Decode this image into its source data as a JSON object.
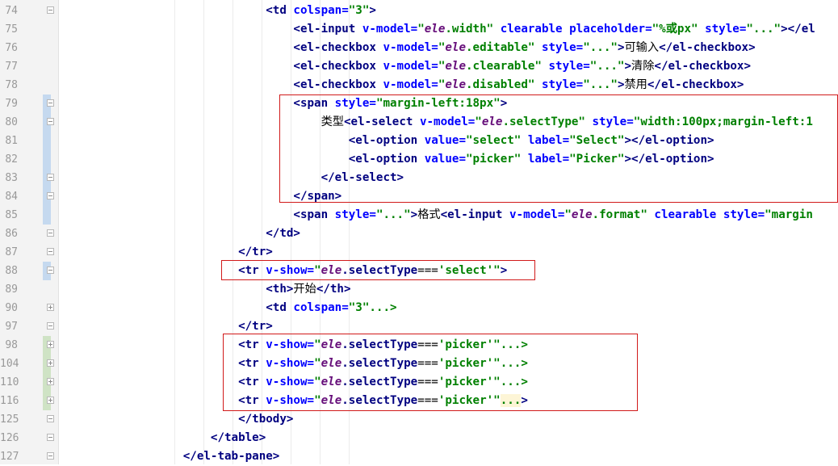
{
  "lines": [
    {
      "num": "74",
      "fold": "minus",
      "vcs": "none",
      "code": [
        {
          "t": "                              "
        },
        {
          "t": "<td ",
          "c": "tag"
        },
        {
          "t": "colspan",
          "c": "attr"
        },
        {
          "t": "=",
          "c": "attr"
        },
        {
          "t": "\"3\"",
          "c": "str"
        },
        {
          "t": ">",
          "c": "tag"
        }
      ]
    },
    {
      "num": "75",
      "fold": "",
      "vcs": "none",
      "code": [
        {
          "t": "                                  "
        },
        {
          "t": "<el-input ",
          "c": "tag"
        },
        {
          "t": "v-model",
          "c": "attr"
        },
        {
          "t": "=",
          "c": "attr"
        },
        {
          "t": "\"",
          "c": "str"
        },
        {
          "t": "ele",
          "c": "vvar"
        },
        {
          "t": ".width\"",
          "c": "str"
        },
        {
          "t": " "
        },
        {
          "t": "clearable",
          "c": "attr"
        },
        {
          "t": " "
        },
        {
          "t": "placeholder",
          "c": "attr"
        },
        {
          "t": "=",
          "c": "attr"
        },
        {
          "t": "\"%或px\"",
          "c": "str"
        },
        {
          "t": " "
        },
        {
          "t": "style",
          "c": "attr"
        },
        {
          "t": "=",
          "c": "attr"
        },
        {
          "t": "\"...\"",
          "c": "str"
        },
        {
          "t": "></el",
          "c": "tag"
        }
      ]
    },
    {
      "num": "76",
      "fold": "",
      "vcs": "none",
      "code": [
        {
          "t": "                                  "
        },
        {
          "t": "<el-checkbox ",
          "c": "tag"
        },
        {
          "t": "v-model",
          "c": "attr"
        },
        {
          "t": "=",
          "c": "attr"
        },
        {
          "t": "\"",
          "c": "str"
        },
        {
          "t": "ele",
          "c": "vvar"
        },
        {
          "t": ".editable\"",
          "c": "str"
        },
        {
          "t": " "
        },
        {
          "t": "style",
          "c": "attr"
        },
        {
          "t": "=",
          "c": "attr"
        },
        {
          "t": "\"...\"",
          "c": "str"
        },
        {
          "t": ">",
          "c": "tag"
        },
        {
          "t": "可输入",
          "c": "txt"
        },
        {
          "t": "</el-checkbox>",
          "c": "tag"
        }
      ]
    },
    {
      "num": "77",
      "fold": "",
      "vcs": "none",
      "code": [
        {
          "t": "                                  "
        },
        {
          "t": "<el-checkbox ",
          "c": "tag"
        },
        {
          "t": "v-model",
          "c": "attr"
        },
        {
          "t": "=",
          "c": "attr"
        },
        {
          "t": "\"",
          "c": "str"
        },
        {
          "t": "ele",
          "c": "vvar"
        },
        {
          "t": ".clearable\"",
          "c": "str"
        },
        {
          "t": " "
        },
        {
          "t": "style",
          "c": "attr"
        },
        {
          "t": "=",
          "c": "attr"
        },
        {
          "t": "\"...\"",
          "c": "str"
        },
        {
          "t": ">",
          "c": "tag"
        },
        {
          "t": "清除",
          "c": "txt"
        },
        {
          "t": "</el-checkbox>",
          "c": "tag"
        }
      ]
    },
    {
      "num": "78",
      "fold": "",
      "vcs": "none",
      "code": [
        {
          "t": "                                  "
        },
        {
          "t": "<el-checkbox ",
          "c": "tag"
        },
        {
          "t": "v-model",
          "c": "attr"
        },
        {
          "t": "=",
          "c": "attr"
        },
        {
          "t": "\"",
          "c": "str"
        },
        {
          "t": "ele",
          "c": "vvar"
        },
        {
          "t": ".disabled\"",
          "c": "str"
        },
        {
          "t": " "
        },
        {
          "t": "style",
          "c": "attr"
        },
        {
          "t": "=",
          "c": "attr"
        },
        {
          "t": "\"...\"",
          "c": "str"
        },
        {
          "t": ">",
          "c": "tag"
        },
        {
          "t": "禁用",
          "c": "txt"
        },
        {
          "t": "</el-checkbox>",
          "c": "tag"
        }
      ]
    },
    {
      "num": "79",
      "fold": "minus",
      "vcs": "mod",
      "code": [
        {
          "t": "                                  "
        },
        {
          "t": "<span ",
          "c": "tag"
        },
        {
          "t": "style",
          "c": "attr"
        },
        {
          "t": "=",
          "c": "attr"
        },
        {
          "t": "\"margin-left:18px\"",
          "c": "str"
        },
        {
          "t": ">",
          "c": "tag"
        }
      ]
    },
    {
      "num": "80",
      "fold": "minus",
      "vcs": "mod",
      "code": [
        {
          "t": "                                      "
        },
        {
          "t": "类型",
          "c": "txt"
        },
        {
          "t": "<el-select ",
          "c": "tag"
        },
        {
          "t": "v-model",
          "c": "attr"
        },
        {
          "t": "=",
          "c": "attr"
        },
        {
          "t": "\"",
          "c": "str"
        },
        {
          "t": "ele",
          "c": "vvar"
        },
        {
          "t": ".selectType\"",
          "c": "str"
        },
        {
          "t": " "
        },
        {
          "t": "style",
          "c": "attr"
        },
        {
          "t": "=",
          "c": "attr"
        },
        {
          "t": "\"width:100px;margin-left:1",
          "c": "str"
        }
      ]
    },
    {
      "num": "81",
      "fold": "",
      "vcs": "mod",
      "code": [
        {
          "t": "                                          "
        },
        {
          "t": "<el-option ",
          "c": "tag"
        },
        {
          "t": "value",
          "c": "attr"
        },
        {
          "t": "=",
          "c": "attr"
        },
        {
          "t": "\"select\"",
          "c": "str"
        },
        {
          "t": " "
        },
        {
          "t": "label",
          "c": "attr"
        },
        {
          "t": "=",
          "c": "attr"
        },
        {
          "t": "\"Select\"",
          "c": "str"
        },
        {
          "t": "></el-option>",
          "c": "tag"
        }
      ]
    },
    {
      "num": "82",
      "fold": "",
      "vcs": "mod",
      "code": [
        {
          "t": "                                          "
        },
        {
          "t": "<el-option ",
          "c": "tag"
        },
        {
          "t": "value",
          "c": "attr"
        },
        {
          "t": "=",
          "c": "attr"
        },
        {
          "t": "\"picker\"",
          "c": "str"
        },
        {
          "t": " "
        },
        {
          "t": "label",
          "c": "attr"
        },
        {
          "t": "=",
          "c": "attr"
        },
        {
          "t": "\"Picker\"",
          "c": "str"
        },
        {
          "t": "></el-option>",
          "c": "tag"
        }
      ]
    },
    {
      "num": "83",
      "fold": "minus",
      "vcs": "mod",
      "code": [
        {
          "t": "                                      "
        },
        {
          "t": "</el-select>",
          "c": "tag"
        }
      ]
    },
    {
      "num": "84",
      "fold": "minus",
      "vcs": "mod",
      "code": [
        {
          "t": "                                  "
        },
        {
          "t": "</span>",
          "c": "tag"
        }
      ]
    },
    {
      "num": "85",
      "fold": "",
      "vcs": "mod",
      "code": [
        {
          "t": "                                  "
        },
        {
          "t": "<span ",
          "c": "tag"
        },
        {
          "t": "style",
          "c": "attr"
        },
        {
          "t": "=",
          "c": "attr"
        },
        {
          "t": "\"...\"",
          "c": "str"
        },
        {
          "t": ">",
          "c": "tag"
        },
        {
          "t": "格式",
          "c": "txt"
        },
        {
          "t": "<el-input ",
          "c": "tag"
        },
        {
          "t": "v-model",
          "c": "attr"
        },
        {
          "t": "=",
          "c": "attr"
        },
        {
          "t": "\"",
          "c": "str"
        },
        {
          "t": "ele",
          "c": "vvar"
        },
        {
          "t": ".format\"",
          "c": "str"
        },
        {
          "t": " "
        },
        {
          "t": "clearable",
          "c": "attr"
        },
        {
          "t": " "
        },
        {
          "t": "style",
          "c": "attr"
        },
        {
          "t": "=",
          "c": "attr"
        },
        {
          "t": "\"margin",
          "c": "str"
        }
      ]
    },
    {
      "num": "86",
      "fold": "minus",
      "vcs": "none",
      "code": [
        {
          "t": "                              "
        },
        {
          "t": "</td>",
          "c": "tag"
        }
      ]
    },
    {
      "num": "87",
      "fold": "minus",
      "vcs": "none",
      "code": [
        {
          "t": "                          "
        },
        {
          "t": "</tr>",
          "c": "tag"
        }
      ]
    },
    {
      "num": "88",
      "fold": "minus",
      "vcs": "mod",
      "code": [
        {
          "t": "                          "
        },
        {
          "t": "<tr ",
          "c": "tag"
        },
        {
          "t": "v-show",
          "c": "attr"
        },
        {
          "t": "=",
          "c": "attr"
        },
        {
          "t": "\"",
          "c": "str"
        },
        {
          "t": "ele",
          "c": "vvar"
        },
        {
          "t": ".selectType",
          "c": "tag"
        },
        {
          "t": "===",
          "c": "txt"
        },
        {
          "t": "'select'",
          "c": "str"
        },
        {
          "t": "\"",
          "c": "str"
        },
        {
          "t": ">",
          "c": "tag"
        }
      ]
    },
    {
      "num": "89",
      "fold": "",
      "vcs": "none",
      "code": [
        {
          "t": "                              "
        },
        {
          "t": "<th>",
          "c": "tag"
        },
        {
          "t": "开始",
          "c": "txt"
        },
        {
          "t": "</th>",
          "c": "tag"
        }
      ]
    },
    {
      "num": "90",
      "fold": "plus",
      "vcs": "none",
      "code": [
        {
          "t": "                              "
        },
        {
          "t": "<td ",
          "c": "tag"
        },
        {
          "t": "colspan",
          "c": "attr"
        },
        {
          "t": "=",
          "c": "attr"
        },
        {
          "t": "\"3\"",
          "c": "str"
        },
        {
          "t": "...>",
          "c": "str"
        }
      ]
    },
    {
      "num": "97",
      "fold": "minus",
      "vcs": "none",
      "code": [
        {
          "t": "                          "
        },
        {
          "t": "</tr>",
          "c": "tag"
        }
      ]
    },
    {
      "num": "98",
      "fold": "plus",
      "vcs": "add",
      "code": [
        {
          "t": "                          "
        },
        {
          "t": "<tr ",
          "c": "tag"
        },
        {
          "t": "v-show",
          "c": "attr"
        },
        {
          "t": "=",
          "c": "attr"
        },
        {
          "t": "\"",
          "c": "str"
        },
        {
          "t": "ele",
          "c": "vvar"
        },
        {
          "t": ".selectType",
          "c": "tag"
        },
        {
          "t": "===",
          "c": "txt"
        },
        {
          "t": "'picker'",
          "c": "str"
        },
        {
          "t": "\"...>",
          "c": "str"
        }
      ]
    },
    {
      "num": "104",
      "fold": "plus",
      "vcs": "add",
      "code": [
        {
          "t": "                          "
        },
        {
          "t": "<tr ",
          "c": "tag"
        },
        {
          "t": "v-show",
          "c": "attr"
        },
        {
          "t": "=",
          "c": "attr"
        },
        {
          "t": "\"",
          "c": "str"
        },
        {
          "t": "ele",
          "c": "vvar"
        },
        {
          "t": ".selectType",
          "c": "tag"
        },
        {
          "t": "===",
          "c": "txt"
        },
        {
          "t": "'picker'",
          "c": "str"
        },
        {
          "t": "\"...>",
          "c": "str"
        }
      ]
    },
    {
      "num": "110",
      "fold": "plus",
      "vcs": "add",
      "code": [
        {
          "t": "                          "
        },
        {
          "t": "<tr ",
          "c": "tag"
        },
        {
          "t": "v-show",
          "c": "attr"
        },
        {
          "t": "=",
          "c": "attr"
        },
        {
          "t": "\"",
          "c": "str"
        },
        {
          "t": "ele",
          "c": "vvar"
        },
        {
          "t": ".selectType",
          "c": "tag"
        },
        {
          "t": "===",
          "c": "txt"
        },
        {
          "t": "'picker'",
          "c": "str"
        },
        {
          "t": "\"...>",
          "c": "str"
        }
      ]
    },
    {
      "num": "116",
      "fold": "plus",
      "vcs": "add",
      "code": [
        {
          "t": "                          "
        },
        {
          "t": "<tr ",
          "c": "tag"
        },
        {
          "t": "v-show",
          "c": "attr"
        },
        {
          "t": "=",
          "c": "attr"
        },
        {
          "t": "\"",
          "c": "str"
        },
        {
          "t": "ele",
          "c": "vvar"
        },
        {
          "t": ".selectType",
          "c": "tag"
        },
        {
          "t": "===",
          "c": "txt"
        },
        {
          "t": "'picker'",
          "c": "str"
        },
        {
          "t": "\"",
          "c": "str"
        },
        {
          "t": "...",
          "c": "str hl"
        },
        {
          "t": ">",
          "c": "tag"
        }
      ]
    },
    {
      "num": "125",
      "fold": "minus",
      "vcs": "none",
      "code": [
        {
          "t": "                          "
        },
        {
          "t": "</tbody>",
          "c": "tag"
        }
      ]
    },
    {
      "num": "126",
      "fold": "minus",
      "vcs": "none",
      "code": [
        {
          "t": "                      "
        },
        {
          "t": "</table>",
          "c": "tag"
        }
      ]
    },
    {
      "num": "127",
      "fold": "minus",
      "vcs": "none",
      "code": [
        {
          "t": "                  "
        },
        {
          "t": "</el-tab-pane>",
          "c": "tag"
        }
      ]
    }
  ],
  "colors": {
    "gutter_bg": "#f3f3f3",
    "vcs_modified": "#c5d9ef",
    "vcs_added": "#cfe3c5",
    "annotation_box": "#d11a1a"
  }
}
